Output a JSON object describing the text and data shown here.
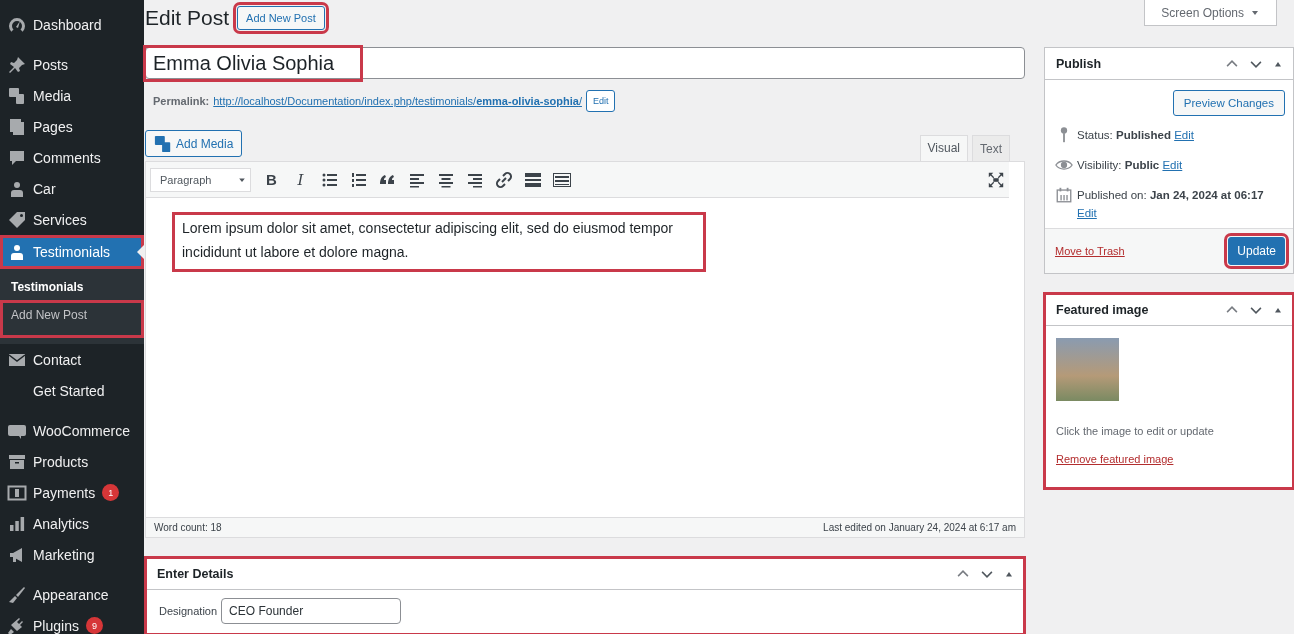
{
  "sidebar": {
    "groups": [
      {
        "items": [
          {
            "label": "Dashboard",
            "selected": false,
            "highlighted": false
          }
        ]
      },
      {
        "items": [
          {
            "label": "Posts",
            "selected": false,
            "highlighted": false
          },
          {
            "label": "Media",
            "selected": false,
            "highlighted": false
          },
          {
            "label": "Pages",
            "selected": false,
            "highlighted": false
          },
          {
            "label": "Comments",
            "selected": false,
            "highlighted": false
          },
          {
            "label": "Car",
            "selected": false,
            "highlighted": false
          },
          {
            "label": "Services",
            "selected": false,
            "highlighted": false
          },
          {
            "label": "Testimonials",
            "selected": true,
            "highlighted": true,
            "submenu": [
              {
                "label": "Testimonials",
                "selected": true,
                "highlighted": false
              },
              {
                "label": "Add New Post",
                "selected": false,
                "highlighted": true
              }
            ]
          },
          {
            "label": "Contact",
            "selected": false,
            "highlighted": false
          },
          {
            "label": "Get Started",
            "selected": false,
            "highlighted": false
          }
        ]
      },
      {
        "items": [
          {
            "label": "WooCommerce",
            "selected": false,
            "highlighted": false
          },
          {
            "label": "Products",
            "selected": false,
            "highlighted": false
          },
          {
            "label": "Payments",
            "selected": false,
            "highlighted": false,
            "badge": "1"
          },
          {
            "label": "Analytics",
            "selected": false,
            "highlighted": false
          },
          {
            "label": "Marketing",
            "selected": false,
            "highlighted": false
          }
        ]
      },
      {
        "items": [
          {
            "label": "Appearance",
            "selected": false,
            "highlighted": false
          },
          {
            "label": "Plugins",
            "selected": false,
            "highlighted": false,
            "badge": "9"
          }
        ]
      }
    ]
  },
  "header": {
    "title": "Edit Post",
    "add_new": {
      "label": "Add New Post",
      "highlighted": true
    },
    "screen_options": "Screen Options"
  },
  "title_field": {
    "value": "Emma Olivia Sophia",
    "highlighted": true
  },
  "permalink": {
    "label": "Permalink:",
    "url": "http://localhost/Documentation/index.php/testimonials/**emma-olivia-sophia**/",
    "edit": "Edit"
  },
  "add_media": "Add Media",
  "editor_tabs": [
    {
      "label": "Visual",
      "selected": true
    },
    {
      "label": "Text",
      "selected": false
    }
  ],
  "toolbar": {
    "format": "Paragraph",
    "bold": "B",
    "italic": "I"
  },
  "content": {
    "text": "Lorem ipsum dolor sit amet, consectetur adipiscing elit, sed do eiusmod tempor incididunt ut labore et dolore magna.",
    "highlighted": true
  },
  "status": {
    "word_count": "Word count: 18",
    "last_edited": "Last edited on January 24, 2024 at 6:17 am"
  },
  "details_box": {
    "title": "Enter Details",
    "highlighted": true,
    "fields": [
      {
        "label": "Designation",
        "value": "CEO Founder"
      }
    ]
  },
  "publish": {
    "title": "Publish",
    "preview": "Preview Changes",
    "rows": [
      {
        "label": "Status:",
        "value": "Published",
        "link": "Edit"
      },
      {
        "label": "Visibility:",
        "value": "Public",
        "link": "Edit"
      },
      {
        "label": "Published on:",
        "value": "Jan 24, 2024 at 06:17",
        "link": "Edit"
      }
    ],
    "trash": "Move to Trash",
    "update": {
      "label": "Update",
      "highlighted": true
    }
  },
  "featured": {
    "title": "Featured image",
    "highlighted": true,
    "hint": "Click the image to edit or update",
    "remove": "Remove featured image"
  }
}
